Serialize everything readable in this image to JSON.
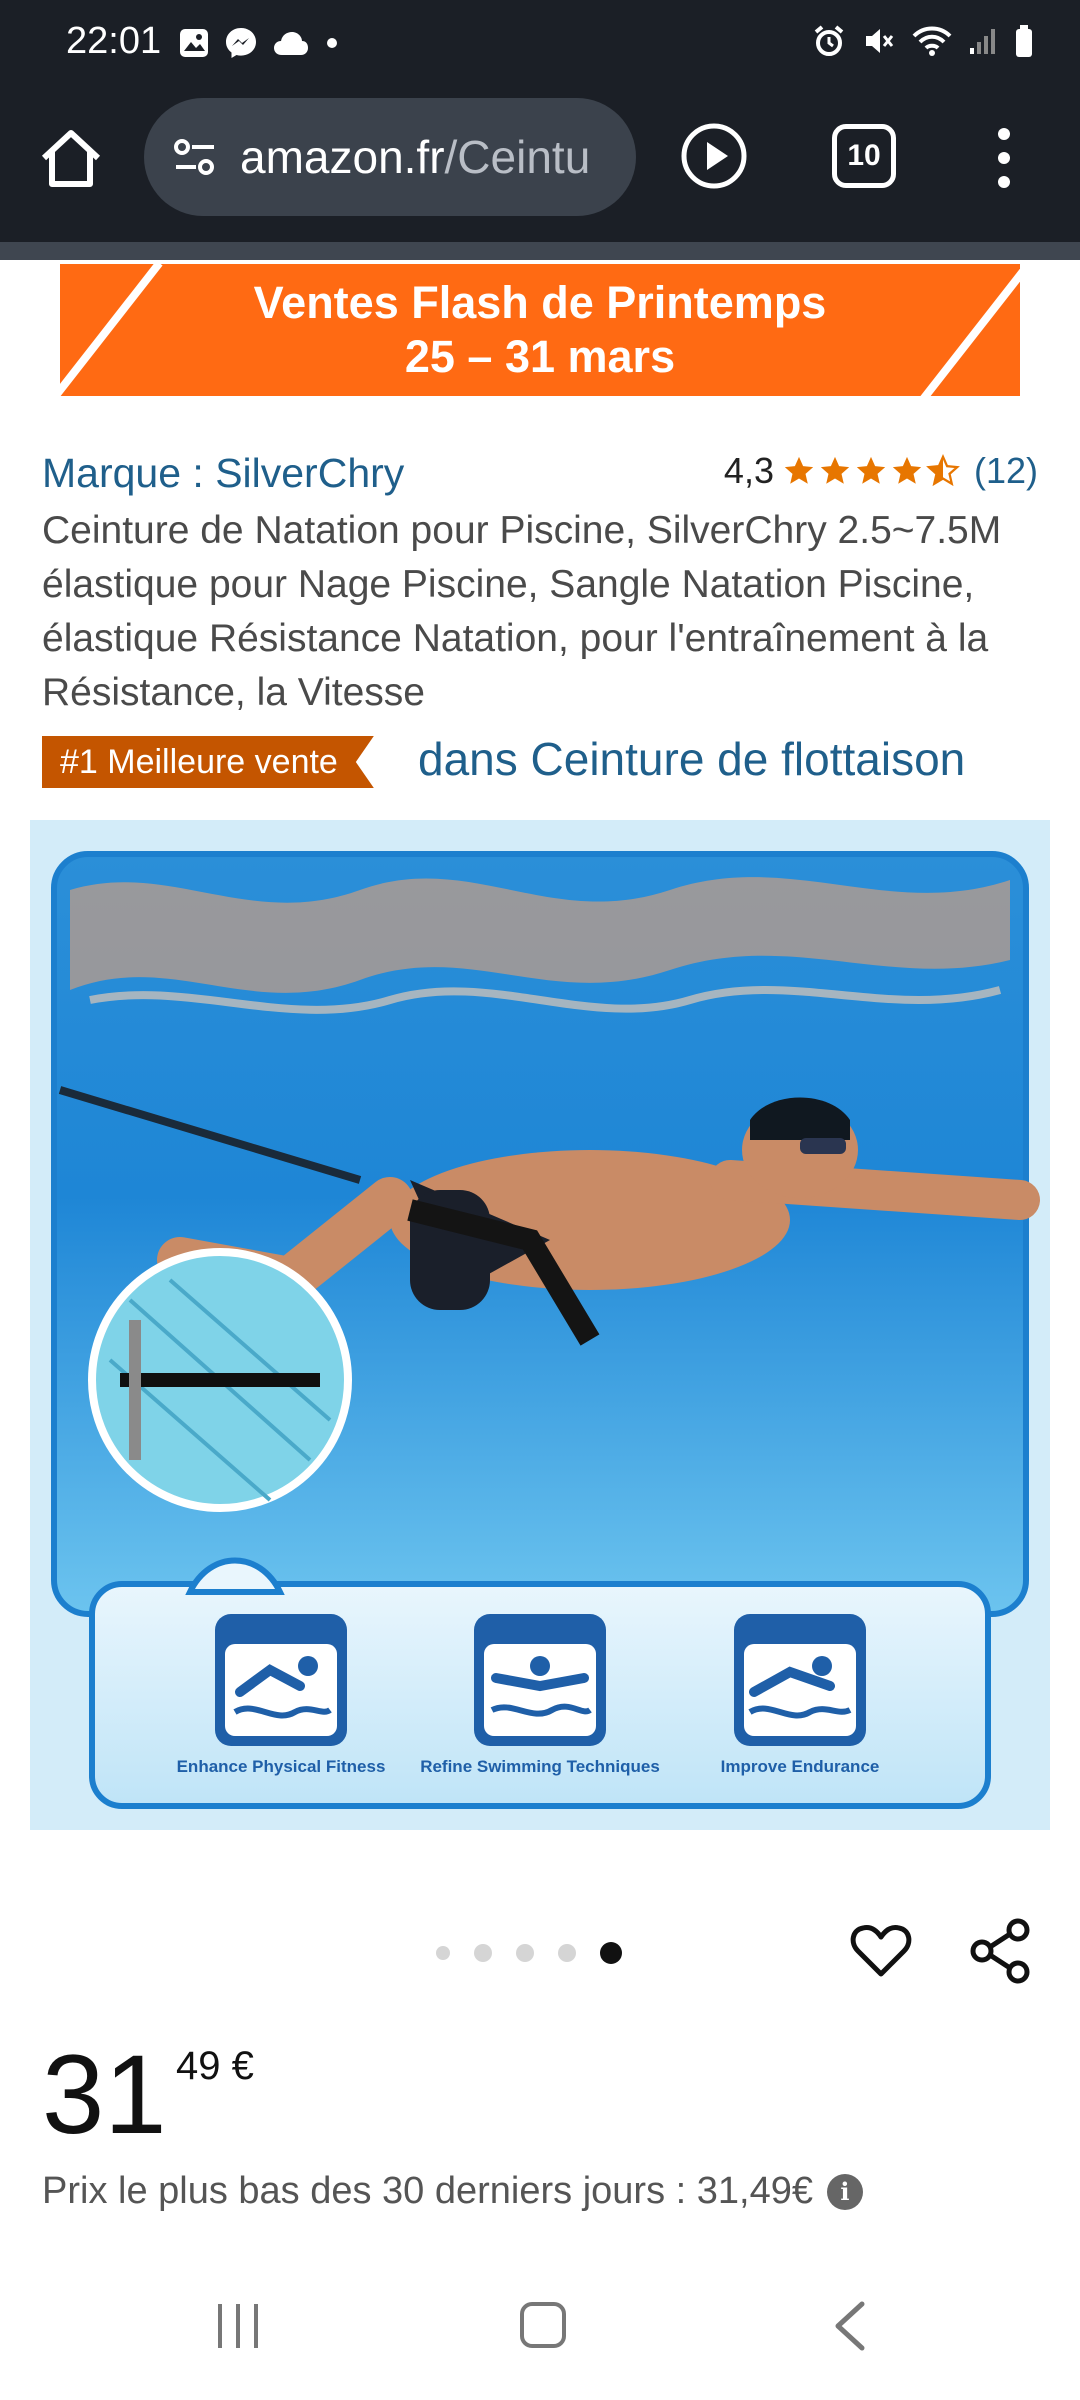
{
  "status_bar": {
    "time": "22:01"
  },
  "browser": {
    "url_domain": "amazon.fr",
    "url_path": "/Ceintu",
    "tabs_count": "10"
  },
  "banner": {
    "line1": "Ventes Flash de Printemps",
    "line2": "25 – 31 mars",
    "color": "#ff6a13"
  },
  "product": {
    "brand": "Marque : SilverChry",
    "rating_value": "4,3",
    "rating": 4.3,
    "rating_count": "(12)",
    "title": "Ceinture de Natation pour Piscine, SilverChry 2.5~7.5M élastique pour Nage Piscine, Sangle Natation Piscine, élastique Résistance Natation, pour l'entraînement à la Résistance, la Vitesse",
    "badge": "#1 Meilleure vente",
    "badge_category": "dans Ceinture de flottaison",
    "image_features": [
      {
        "label": "Enhance Physical Fitness",
        "icon": "swimmer-icon"
      },
      {
        "label": "Refine Swimming Techniques",
        "icon": "swimmer-butterfly-icon"
      },
      {
        "label": "Improve Endurance",
        "icon": "swimmer-crawl-icon"
      }
    ],
    "carousel_total": 5,
    "carousel_active": 5
  },
  "price": {
    "whole": "31",
    "fraction": "49 €",
    "lowest_label": "Prix le plus bas des 30 derniers jours : 31,49€"
  },
  "colors": {
    "link": "#1f5f8b",
    "badge": "#c45500",
    "star": "#e77600"
  }
}
